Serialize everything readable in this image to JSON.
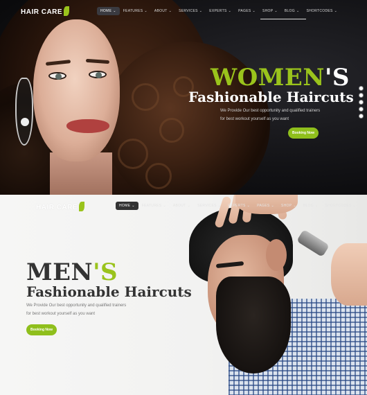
{
  "colors": {
    "accent": "#9ac31c",
    "dark_bg": "#121215",
    "light_bg": "#f4f4f3"
  },
  "women_hero": {
    "logo": "HAIR CARE",
    "nav": [
      {
        "label": "HOME",
        "caret": "⌄"
      },
      {
        "label": "FEATURES",
        "caret": "⌄"
      },
      {
        "label": "ABOUT",
        "caret": "⌄"
      },
      {
        "label": "SERVICES",
        "caret": "⌄"
      },
      {
        "label": "EXPERTS",
        "caret": "⌄"
      },
      {
        "label": "PAGES",
        "caret": "⌄"
      },
      {
        "label": "SHOP",
        "caret": "⌄"
      },
      {
        "label": "BLOG",
        "caret": "⌄"
      },
      {
        "label": "SHORTCODES",
        "caret": "⌄"
      }
    ],
    "title_accent": "WOMEN",
    "title_rest": "'S",
    "subtitle": "Fashionable Haircuts",
    "desc_line1": "We Provide Our best opportunity and qualified trainers",
    "desc_line2": "for best workout yourself as you want",
    "button": "Booking Now",
    "social_icons": [
      "facebook-icon",
      "twitter-icon",
      "google-plus-icon",
      "linkedin-icon",
      "pinterest-icon"
    ]
  },
  "men_hero": {
    "logo": "HAIR CARE",
    "nav": [
      {
        "label": "HOME",
        "caret": "⌄"
      },
      {
        "label": "FEATURES",
        "caret": "⌄"
      },
      {
        "label": "ABOUT",
        "caret": "⌄"
      },
      {
        "label": "SERVICES",
        "caret": "⌄"
      },
      {
        "label": "EXPERTS",
        "caret": "⌄"
      },
      {
        "label": "PAGES",
        "caret": "⌄"
      },
      {
        "label": "SHOP",
        "caret": "⌄"
      },
      {
        "label": "BLOG",
        "caret": "⌄"
      },
      {
        "label": "SHORTCODES",
        "caret": "⌄"
      }
    ],
    "title_main": "MEN",
    "title_accent": "'S",
    "subtitle": "Fashionable Haircuts",
    "desc_line1": "We Provide Our best opportunity and qualified trainers",
    "desc_line2": "for best workout yourself as you want",
    "button": "Booking Now"
  }
}
